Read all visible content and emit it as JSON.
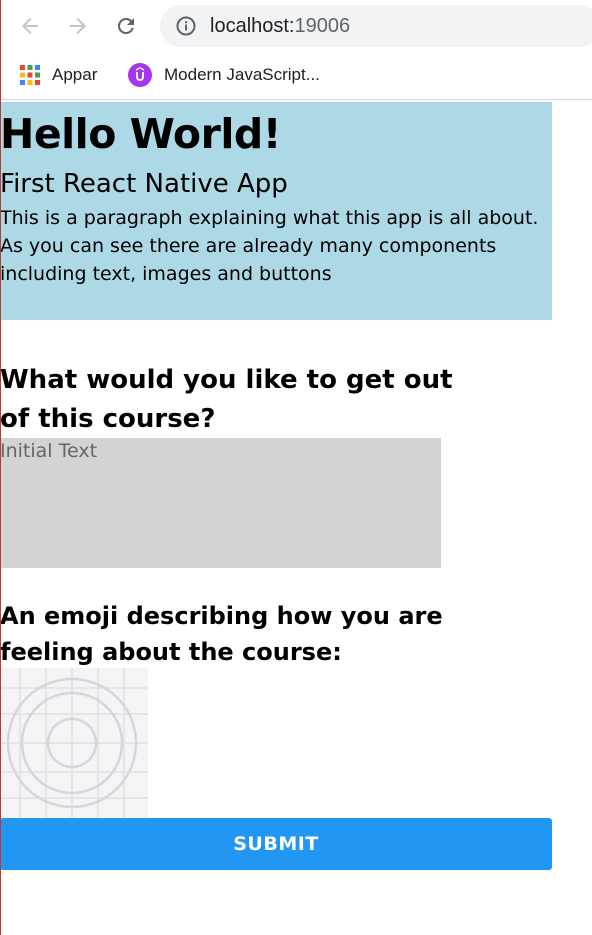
{
  "browser": {
    "url_host": "localhost:",
    "url_port": "19006",
    "bookmarks": [
      {
        "label": "Appar",
        "icon": "apps-grid-icon"
      },
      {
        "label": "Modern JavaScript...",
        "icon": "udemy-icon"
      }
    ]
  },
  "app": {
    "title": "Hello World!",
    "subtitle": "First React Native App",
    "paragraph": "This is a paragraph explaining what this app is all about. As you can see there are already many components including text, images and buttons",
    "question1": "What would you like to get out of this course?",
    "input_placeholder": "Initial Text",
    "question2": "An emoji describing how you are feeling about the course:",
    "submit_label": "SUBMIT"
  },
  "colors": {
    "header_bg": "#add8e6",
    "input_bg": "#d3d3d3",
    "submit_bg": "#2196f3"
  }
}
